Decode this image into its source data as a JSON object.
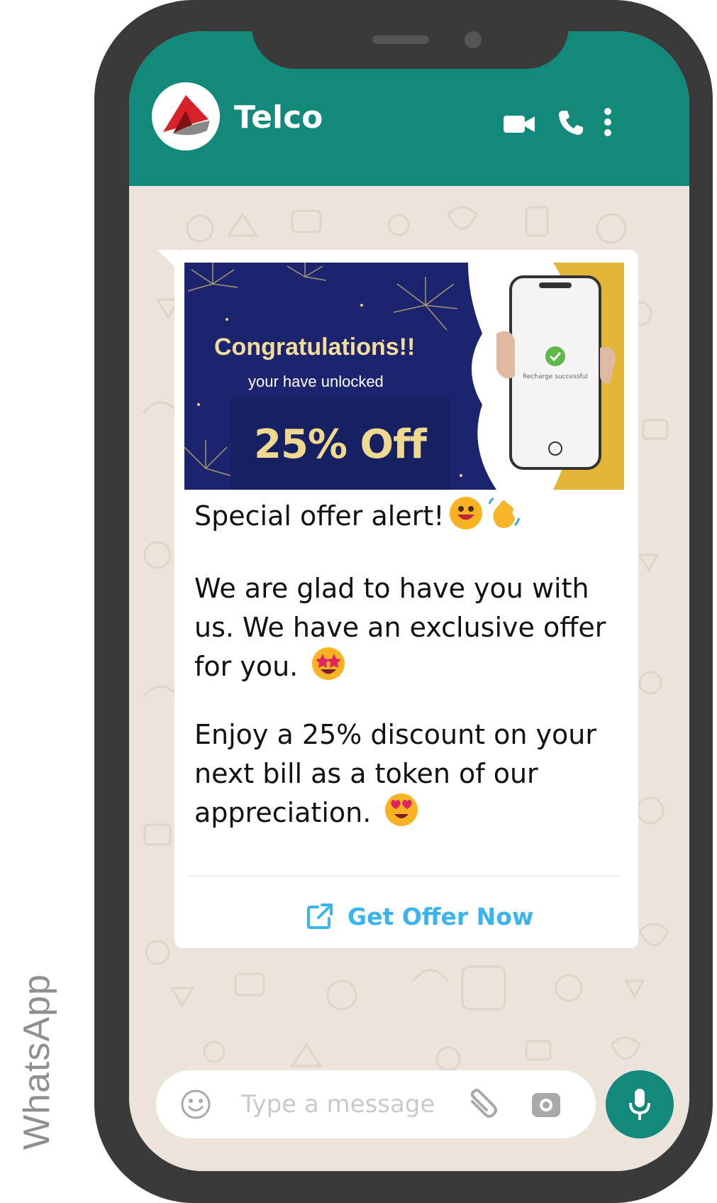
{
  "side_label": "WhatsApp",
  "header": {
    "contact_name": "Telco",
    "icons": [
      "video-call-icon",
      "voice-call-icon",
      "more-options-icon"
    ]
  },
  "message": {
    "banner": {
      "headline": "Congratulations!!",
      "subline": "your have unlocked",
      "discount": "25% Off",
      "phone_screen_text": "Recharge successful"
    },
    "paragraph_1": "Special offer alert!",
    "paragraph_2": "We are glad to have you with us. We have an exclusive offer for you.",
    "paragraph_3": "Enjoy a 25% discount on your next bill as a token of our appreciation.",
    "emojis": [
      "grinning-face",
      "waving-hand",
      "star-struck",
      "heart-eyes"
    ],
    "cta_label": "Get Offer Now"
  },
  "composer": {
    "placeholder": "Type a message",
    "icons": [
      "emoji-icon",
      "attach-icon",
      "camera-icon",
      "mic-icon"
    ]
  },
  "colors": {
    "header": "#13897b",
    "cta": "#3ab4ee",
    "banner_bg": "#1c2470",
    "discount_text": "#efd98f"
  }
}
